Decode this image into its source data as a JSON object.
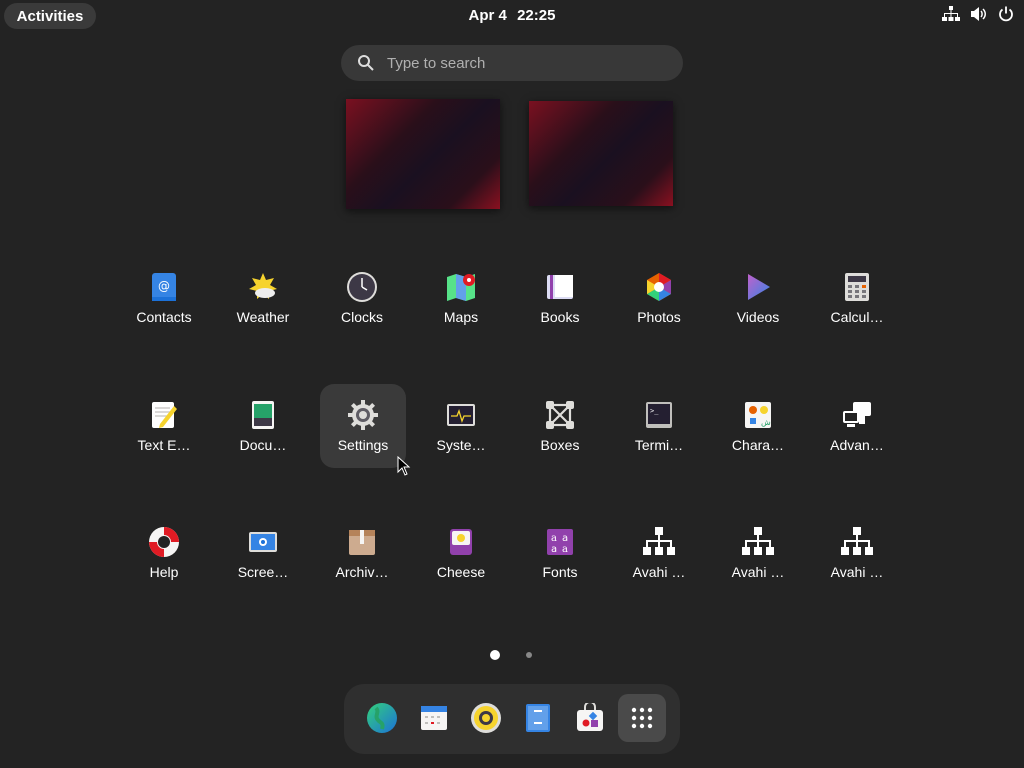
{
  "topbar": {
    "activities": "Activities",
    "date": "Apr 4",
    "time": "22:25",
    "status_icons": [
      "network-icon",
      "volume-icon",
      "power-icon"
    ]
  },
  "search": {
    "placeholder": "Type to search"
  },
  "apps": [
    {
      "label": "Contacts",
      "icon": "contacts-icon"
    },
    {
      "label": "Weather",
      "icon": "weather-icon"
    },
    {
      "label": "Clocks",
      "icon": "clock-icon"
    },
    {
      "label": "Maps",
      "icon": "maps-icon"
    },
    {
      "label": "Books",
      "icon": "books-icon"
    },
    {
      "label": "Photos",
      "icon": "photos-icon"
    },
    {
      "label": "Videos",
      "icon": "videos-icon"
    },
    {
      "label": "Calcul…",
      "icon": "calculator-icon"
    },
    {
      "label": "Text E…",
      "icon": "text-editor-icon"
    },
    {
      "label": "Docu…",
      "icon": "document-viewer-icon"
    },
    {
      "label": "Settings",
      "icon": "settings-icon",
      "highlighted": true
    },
    {
      "label": "Syste…",
      "icon": "system-monitor-icon"
    },
    {
      "label": "Boxes",
      "icon": "boxes-icon"
    },
    {
      "label": "Termi…",
      "icon": "terminal-icon"
    },
    {
      "label": "Chara…",
      "icon": "characters-icon"
    },
    {
      "label": "Advan…",
      "icon": "advanced-network-icon"
    },
    {
      "label": "Help",
      "icon": "help-icon"
    },
    {
      "label": "Scree…",
      "icon": "screenshot-icon"
    },
    {
      "label": "Archiv…",
      "icon": "archive-manager-icon"
    },
    {
      "label": "Cheese",
      "icon": "cheese-icon"
    },
    {
      "label": "Fonts",
      "icon": "fonts-icon"
    },
    {
      "label": "Avahi …",
      "icon": "avahi-icon"
    },
    {
      "label": "Avahi …",
      "icon": "avahi-icon"
    },
    {
      "label": "Avahi …",
      "icon": "avahi-icon"
    }
  ],
  "pages": {
    "current": 1,
    "total": 2
  },
  "dash": [
    "browser-icon",
    "calendar-icon",
    "rhythmbox-icon",
    "files-icon",
    "software-icon",
    "show-apps-icon"
  ]
}
